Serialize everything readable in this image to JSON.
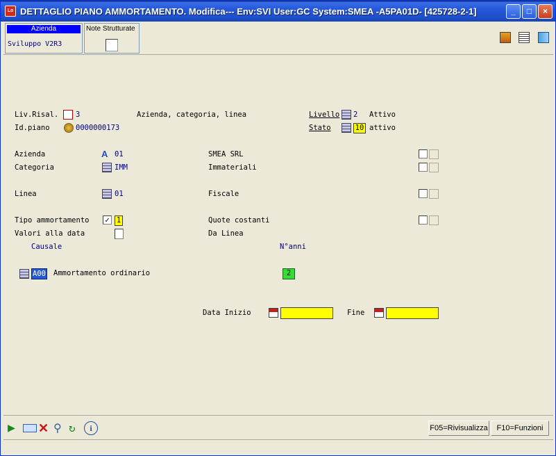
{
  "window": {
    "title": "DETTAGLIO PIANO AMMORTAMENTO.  Modifica--- Env:SVI User:GC System:SMEA -A5PA01D- [425728-2-1]",
    "minimize": "_",
    "maximize": "□",
    "close": "×"
  },
  "header": {
    "azienda_label": "Azienda",
    "azienda_value": "Sviluppo V2R3",
    "note_label": "Note Strutturate"
  },
  "form": {
    "liv_risal_label": "Liv.Risal.",
    "liv_risal_value": "3",
    "liv_risal_desc": "Azienda, categoria, linea",
    "livello_label": "Livello",
    "livello_value": "2",
    "livello_desc": "Attivo",
    "id_piano_label": "Id.piano",
    "id_piano_value": "0000000173",
    "stato_label": "Stato",
    "stato_value": "10",
    "stato_desc": "attivo",
    "azienda_label": "Azienda",
    "azienda_value": "01",
    "azienda_desc": "SMEA SRL",
    "categoria_label": "Categoria",
    "categoria_value": "IMM",
    "categoria_desc": "Immateriali",
    "linea_label": "Linea",
    "linea_value": "01",
    "linea_desc": "Fiscale",
    "tipo_label": "Tipo ammortamento",
    "tipo_value": "1",
    "tipo_desc": "Quote costanti",
    "valori_label": "Valori alla data",
    "valori_desc": "Da Linea",
    "causale_header": "Causale",
    "nanni_header": "N°anni",
    "causale_code": "A00",
    "causale_desc": "Ammortamento ordinario",
    "nanni_value": "2",
    "data_inizio_label": "Data Inizio",
    "fine_label": "Fine"
  },
  "footer": {
    "f05": "F05=Rivisualizza",
    "f10": "F10=Funzioni"
  },
  "colors": {
    "titlebar": "#2458d9",
    "field_yellow": "#ffff00",
    "field_green": "#33dd33",
    "value_text": "#000080"
  }
}
